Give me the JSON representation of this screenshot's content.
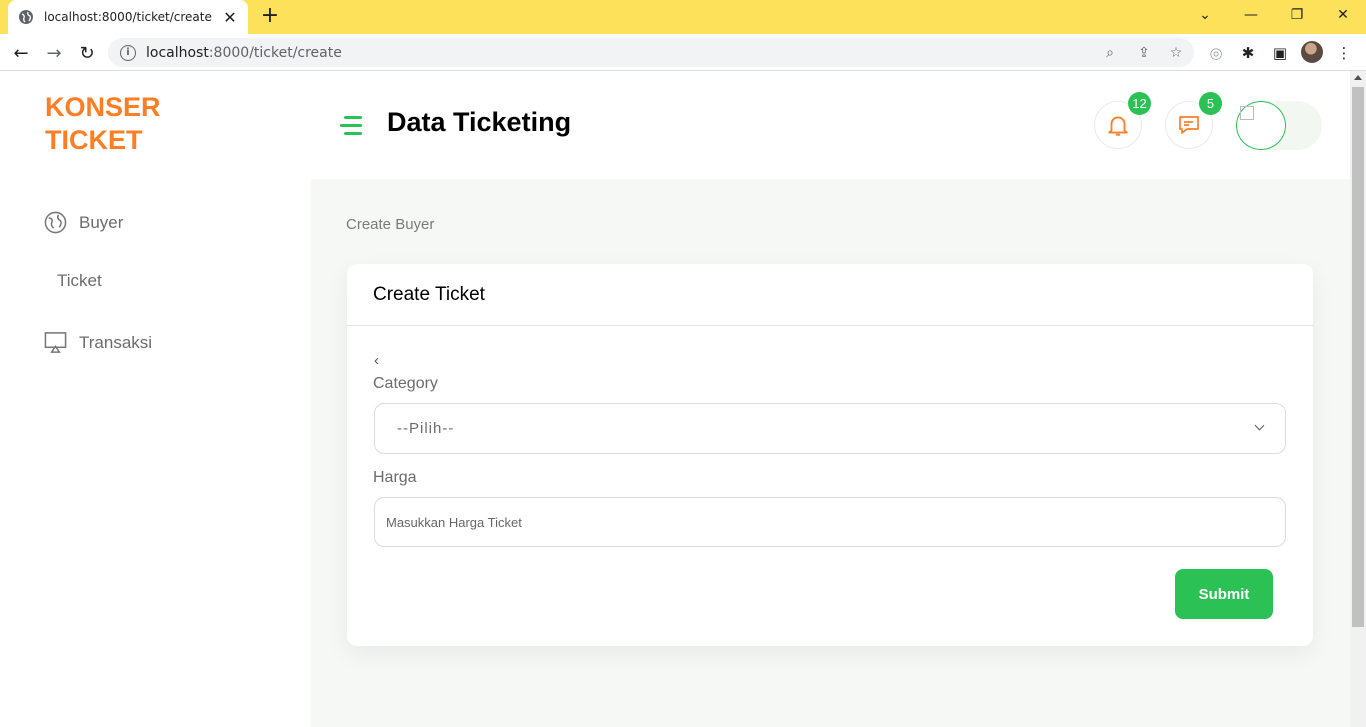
{
  "browser": {
    "tab_title": "localhost:8000/ticket/create",
    "url_host": "localhost",
    "url_rest": ":8000/ticket/create",
    "new_tab": "+",
    "close_tab": "✕"
  },
  "app": {
    "brand_line1": "KONSER",
    "brand_line2": "TICKET",
    "page_title": "Data Ticketing",
    "accent_color": "#2bc155",
    "brand_color": "#fd7e24"
  },
  "sidebar": {
    "items": [
      {
        "label": "Buyer",
        "icon": "globe-icon"
      },
      {
        "label": "Ticket",
        "icon": ""
      },
      {
        "label": "Transaksi",
        "icon": "monitor-icon"
      }
    ]
  },
  "header": {
    "notifications_count": "12",
    "messages_count": "5"
  },
  "breadcrumb": "Create Buyer",
  "form": {
    "title": "Create Ticket",
    "back": "‹",
    "category_label": "Category",
    "category_value": "--Pilih--",
    "price_label": "Harga",
    "price_placeholder": "Masukkan Harga Ticket",
    "submit_label": "Submit"
  }
}
